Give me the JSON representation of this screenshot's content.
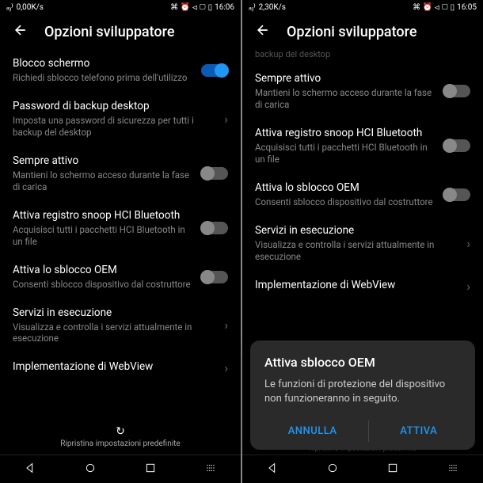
{
  "left": {
    "status": {
      "signal": "ₐ₎⁾",
      "speed": "0,00K/s",
      "icons": "⌘ ⏰ ⏿ ▢",
      "time": "16:06",
      "battery": "▯"
    },
    "title": "Opzioni sviluppatore",
    "items": [
      {
        "title": "Blocco schermo",
        "sub": "Richiedi sblocco telefono prima dell'utilizzo",
        "type": "toggle",
        "on": true
      },
      {
        "title": "Password di backup desktop",
        "sub": "Imposta una password di sicurezza per tutti i backup del desktop",
        "type": "link"
      },
      {
        "title": "Sempre attivo",
        "sub": "Mantieni lo schermo acceso durante la fase di carica",
        "type": "toggle",
        "on": false
      },
      {
        "title": "Attiva registro snoop HCI Bluetooth",
        "sub": "Acquisisci tutti i pacchetti HCI Bluetooth in un file",
        "type": "toggle",
        "on": false
      },
      {
        "title": "Attiva lo sblocco OEM",
        "sub": "Consenti sblocco dispositivo dal costruttore",
        "type": "toggle",
        "on": false
      },
      {
        "title": "Servizi in esecuzione",
        "sub": "Visualizza e controlla i servizi attualmente in esecuzione",
        "type": "link"
      },
      {
        "title": "Implementazione di WebView",
        "sub": "",
        "type": "link"
      }
    ],
    "reset": "Ripristina impostazioni predefinite"
  },
  "right": {
    "status": {
      "signal": "ₐ₎⁾",
      "speed": "2,30K/s",
      "icons": "⌘ ⏰ ⏿ ▢",
      "time": "16:05",
      "battery": "▯"
    },
    "title": "Opzioni sviluppatore",
    "cutoff": "backup del desktop",
    "items": [
      {
        "title": "Sempre attivo",
        "sub": "Mantieni lo schermo acceso durante la fase di carica",
        "type": "toggle",
        "on": false
      },
      {
        "title": "Attiva registro snoop HCI Bluetooth",
        "sub": "Acquisisci tutti i pacchetti HCI Bluetooth in un file",
        "type": "toggle",
        "on": false
      },
      {
        "title": "Attiva lo sblocco OEM",
        "sub": "Consenti sblocco dispositivo dal costruttore",
        "type": "toggle",
        "on": false
      },
      {
        "title": "Servizi in esecuzione",
        "sub": "Visualizza e controlla i servizi attualmente in esecuzione",
        "type": "link"
      },
      {
        "title": "Implementazione di WebView",
        "sub": "",
        "type": "link"
      }
    ],
    "dialog": {
      "title": "Attiva sblocco OEM",
      "text": "Le funzioni di protezione del dispositivo non funzioneranno in seguito.",
      "cancel": "ANNULLA",
      "confirm": "ATTIVA"
    },
    "behind": "Ripristina impostazioni predefinite"
  }
}
